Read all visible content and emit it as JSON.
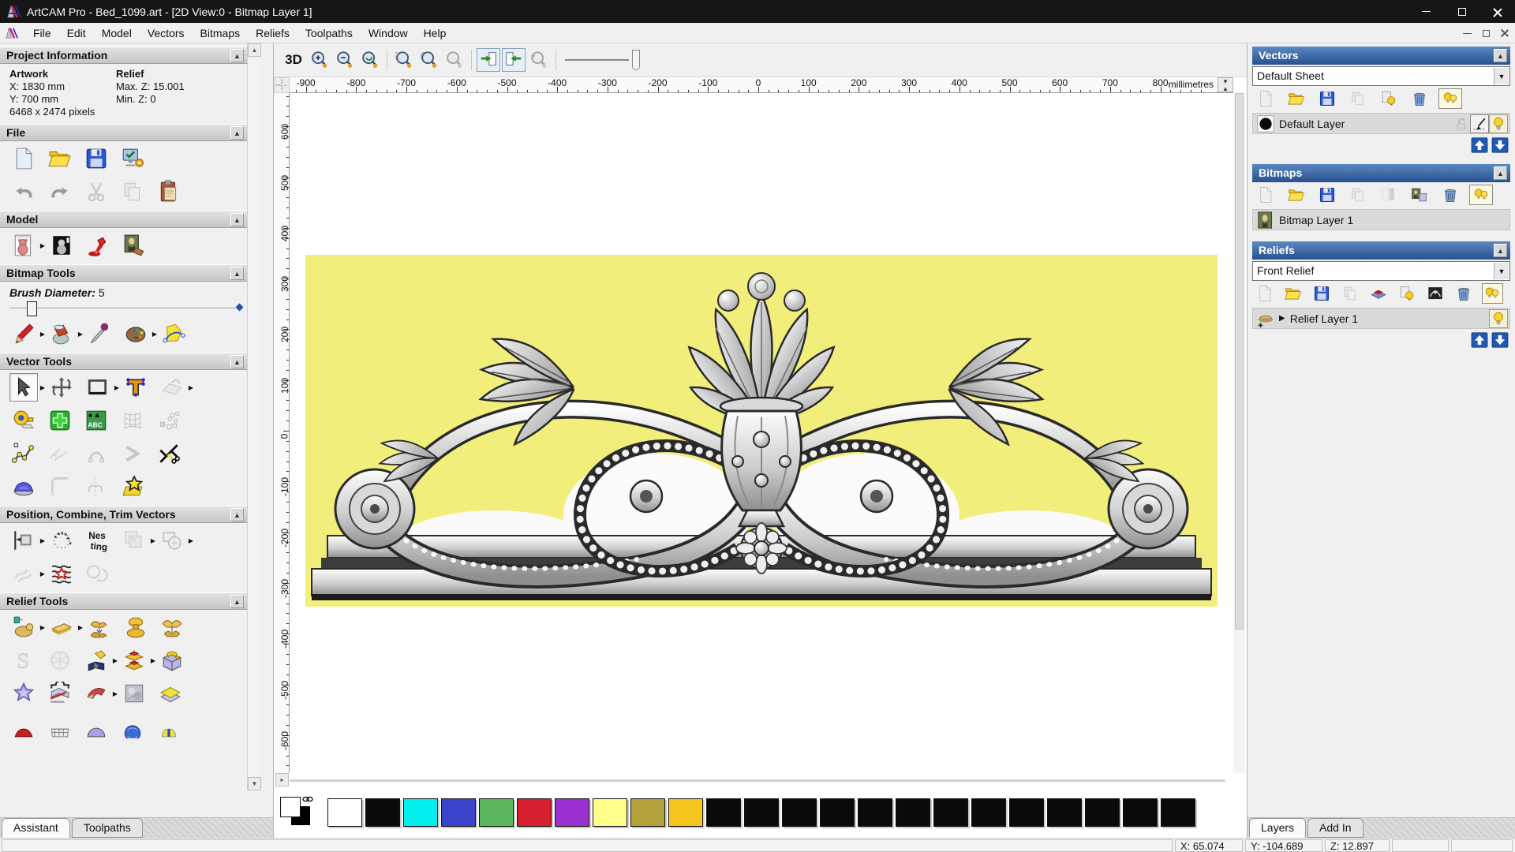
{
  "window": {
    "title": "ArtCAM Pro - Bed_1099.art - [2D View:0 - Bitmap Layer 1]",
    "menus": [
      "File",
      "Edit",
      "Model",
      "Vectors",
      "Bitmaps",
      "Reliefs",
      "Toolpaths",
      "Window",
      "Help"
    ]
  },
  "left_panel": {
    "sections": {
      "project": {
        "title": "Project Information",
        "artwork_label": "Artwork",
        "relief_label": "Relief",
        "x": "X: 1830 mm",
        "max_z": "Max. Z: 15.001",
        "y": "Y: 700 mm",
        "min_z": "Min. Z: 0",
        "pixels": "6468 x 2474 pixels"
      },
      "file": {
        "title": "File",
        "rows": [
          [
            {
              "n": "new-model-button",
              "k": "doc"
            },
            {
              "n": "open-model-button",
              "k": "folder"
            },
            {
              "n": "save-model-button",
              "k": "floppy"
            },
            {
              "n": "model-wizard-button",
              "k": "wizard"
            }
          ],
          [
            {
              "n": "undo-button",
              "k": "undo"
            },
            {
              "n": "redo-button",
              "k": "redo"
            },
            {
              "n": "cut-button",
              "k": "scissors",
              "dis": true
            },
            {
              "n": "copy-button",
              "k": "copy",
              "dis": true
            },
            {
              "n": "paste-button",
              "k": "paste"
            }
          ]
        ]
      },
      "model": {
        "title": "Model",
        "rows": [
          [
            {
              "n": "set-model-size-button",
              "k": "teddy_page",
              "fly": true
            },
            {
              "n": "greyscale-view-button",
              "k": "teddy_bw"
            },
            {
              "n": "lighting-button",
              "k": "lamp"
            },
            {
              "n": "texture-button",
              "k": "mona"
            }
          ]
        ]
      },
      "bitmap_tools": {
        "title": "Bitmap Tools",
        "brush_label": "Brush Diameter:",
        "brush_value": "5",
        "rows": [
          [
            {
              "n": "paint-button",
              "k": "pencil",
              "fly": true
            },
            {
              "n": "flood-fill-button",
              "k": "bucket",
              "fly": true
            },
            {
              "n": "pick-colour-button",
              "k": "dropper"
            },
            {
              "n": "colour-palette-button",
              "k": "palette",
              "fly": true
            },
            {
              "n": "bitmap-to-vector-button",
              "k": "btv"
            }
          ]
        ]
      },
      "vector_tools": {
        "title": "Vector Tools",
        "rows": [
          [
            {
              "n": "select-vectors-button",
              "k": "cursor",
              "pressed": true,
              "fly": true
            },
            {
              "n": "transform-vectors-button",
              "k": "transform"
            },
            {
              "n": "create-rectangle-button",
              "k": "rect",
              "fly": true
            },
            {
              "n": "create-text-button",
              "k": "textT"
            },
            {
              "n": "wrap-text-button",
              "k": "wrap",
              "dis": true,
              "fly": true
            }
          ],
          [
            {
              "n": "measure-button",
              "k": "measure"
            },
            {
              "n": "create-shape-button",
              "k": "plusg"
            },
            {
              "n": "paste-text-button",
              "k": "abc"
            },
            {
              "n": "distort-vectors-button",
              "k": "distort",
              "dis": true
            },
            {
              "n": "snap-points-button",
              "k": "snap",
              "dis": true
            }
          ],
          [
            {
              "n": "create-polyline-button",
              "k": "polyline"
            },
            {
              "n": "free-sketch-button",
              "k": "sketch",
              "dis": true
            },
            {
              "n": "arc-fit-button",
              "k": "arc",
              "dis": true
            },
            {
              "n": "create-arc-button",
              "k": "chevron",
              "dis": true
            },
            {
              "n": "trim-vectors-button",
              "k": "trim"
            }
          ],
          [
            {
              "n": "extrude-button",
              "k": "dome"
            },
            {
              "n": "fillet-button",
              "k": "fillet",
              "dis": true
            },
            {
              "n": "clip-vectors-button",
              "k": "clip",
              "dis": true
            },
            {
              "n": "vector-doctor-button",
              "k": "starfolder"
            }
          ]
        ]
      },
      "position": {
        "title": "Position, Combine, Trim Vectors",
        "rows": [
          [
            {
              "n": "align-vectors-button",
              "k": "align",
              "fly": true
            },
            {
              "n": "text-on-curve-button",
              "k": "textcurve"
            },
            {
              "n": "nesting-button",
              "k": "nesting"
            },
            {
              "n": "group-vectors-button",
              "k": "group",
              "dis": true,
              "fly": true
            },
            {
              "n": "weld-vectors-button",
              "k": "weld",
              "dis": true,
              "fly": true
            }
          ],
          [
            {
              "n": "join-vectors-button",
              "k": "join",
              "dis": true,
              "fly": true
            },
            {
              "n": "vector-texture-button",
              "k": "vtexture"
            },
            {
              "n": "interlock-vectors-button",
              "k": "interlock",
              "dis": true
            }
          ]
        ]
      },
      "relief_tools": {
        "title": "Relief Tools",
        "rows": [
          [
            {
              "n": "sculpting-button",
              "k": "sculpt",
              "fly": true
            },
            {
              "n": "smooth-relief-button",
              "k": "smoothbar",
              "fly": true
            },
            {
              "n": "add-relief-button",
              "k": "addgold"
            },
            {
              "n": "subtract-relief-button",
              "k": "subgold"
            },
            {
              "n": "merge-relief-button",
              "k": "mergegold"
            }
          ],
          [
            {
              "n": "smart-engrave-button",
              "k": "sgray",
              "dis": true
            },
            {
              "n": "weave-wizard-button",
              "k": "weave",
              "dis": true
            },
            {
              "n": "relief-from-image-button",
              "k": "bookb",
              "fly": true
            },
            {
              "n": "offset-relief-button",
              "k": "stackyr",
              "fly": true
            },
            {
              "n": "load-replace-relief-button",
              "k": "wrapbox"
            }
          ],
          [
            {
              "n": "shape-editor-button",
              "k": "starpurple"
            },
            {
              "n": "emboss-relief-button",
              "k": "clamp"
            },
            {
              "n": "two-rail-sweep-button",
              "k": "sweep",
              "fly": true
            },
            {
              "n": "texture-relief-button",
              "k": "texsq"
            },
            {
              "n": "offset-layer-button",
              "k": "offstack"
            }
          ],
          [
            {
              "n": "turn-relief-button",
              "k": "hat"
            },
            {
              "n": "weave-relief-button",
              "k": "basket"
            },
            {
              "n": "dome-relief-button",
              "k": "domep"
            },
            {
              "n": "ornament-relief-button",
              "k": "sphereb"
            },
            {
              "n": "wing-relief-button",
              "k": "wings"
            }
          ]
        ]
      }
    },
    "tabs": [
      {
        "label": "Assistant",
        "active": true
      },
      {
        "label": "Toolpaths",
        "active": false
      }
    ]
  },
  "toolbar": {
    "view3d_label": "3D",
    "buttons": [
      {
        "n": "view-3d-button",
        "k": "label3d"
      },
      {
        "n": "zoom-in-button",
        "k": "zoomin"
      },
      {
        "n": "zoom-out-button",
        "k": "zoomout"
      },
      {
        "n": "zoom-reset-button",
        "k": "zoomreset"
      },
      {
        "n": "sep1",
        "k": "sep"
      },
      {
        "n": "zoom-box-button",
        "k": "zoombox"
      },
      {
        "n": "zoom-selection-button",
        "k": "zoomsel"
      },
      {
        "n": "zoom-objects-button",
        "k": "zoomobj",
        "dis": true
      },
      {
        "n": "sep2",
        "k": "sep"
      },
      {
        "n": "pan-previous-button",
        "k": "panl",
        "pressed": true
      },
      {
        "n": "pan-next-button",
        "k": "panr",
        "pressed": true
      },
      {
        "n": "zoom-previous-button",
        "k": "zoomprev",
        "dis": true
      },
      {
        "n": "sep3",
        "k": "sep"
      },
      {
        "n": "simulation-slider",
        "k": "slider"
      }
    ]
  },
  "rulers": {
    "h_labels": [
      -900,
      -800,
      -700,
      -600,
      -500,
      -400,
      -300,
      -200,
      -100,
      0,
      100,
      200,
      300,
      400,
      500,
      600,
      700,
      800
    ],
    "v_labels": [
      600,
      500,
      400,
      300,
      200,
      100,
      0,
      -100,
      -200,
      -300,
      -400,
      -500,
      -600
    ],
    "units": "millimetres"
  },
  "canvas": {
    "artwork_bg": "#f1ee7c"
  },
  "right_panel": {
    "vectors": {
      "title": "Vectors",
      "sheet": "Default Sheet",
      "layer": "Default Layer",
      "icons": [
        {
          "n": "vector-new-layer-button",
          "k": "doc",
          "dis": true
        },
        {
          "n": "vector-open-button",
          "k": "folder"
        },
        {
          "n": "vector-save-button",
          "k": "floppy"
        },
        {
          "n": "vector-merge-button",
          "k": "copy",
          "dis": true
        },
        {
          "n": "sheet-bulb-button",
          "k": "bulbsheet"
        },
        {
          "n": "vector-delete-button",
          "k": "trash"
        },
        {
          "n": "vector-toggle-all-button",
          "k": "bulbs",
          "boxed": true
        }
      ]
    },
    "bitmaps": {
      "title": "Bitmaps",
      "layer": "Bitmap Layer 1",
      "icons": [
        {
          "n": "bitmap-new-layer-button",
          "k": "doc",
          "dis": true
        },
        {
          "n": "bitmap-open-button",
          "k": "folder"
        },
        {
          "n": "bitmap-save-button",
          "k": "floppy"
        },
        {
          "n": "bitmap-merge-button",
          "k": "copy",
          "dis": true
        },
        {
          "n": "bitmap-gradient-button",
          "k": "gradsq",
          "dis": true
        },
        {
          "n": "bitmap-copy-layer-button",
          "k": "monacopy"
        },
        {
          "n": "bitmap-delete-button",
          "k": "trash"
        },
        {
          "n": "bitmap-toggle-all-button",
          "k": "bulbs",
          "boxed": true
        }
      ]
    },
    "reliefs": {
      "title": "Reliefs",
      "relief": "Front Relief",
      "layer": "Relief Layer 1",
      "icons": [
        {
          "n": "relief-new-layer-button",
          "k": "doc",
          "dis": true
        },
        {
          "n": "relief-open-button",
          "k": "folder"
        },
        {
          "n": "relief-save-button",
          "k": "floppy"
        },
        {
          "n": "relief-merge-button",
          "k": "copy",
          "dis": true
        },
        {
          "n": "relief-stack-button",
          "k": "stackrp"
        },
        {
          "n": "relief-bulb-button",
          "k": "bulbsheet"
        },
        {
          "n": "relief-greyscale-button",
          "k": "reliefthumb"
        },
        {
          "n": "relief-delete-button",
          "k": "trash"
        },
        {
          "n": "relief-toggle-all-button",
          "k": "bulbs",
          "boxed": true
        }
      ]
    },
    "tabs": [
      {
        "label": "Layers",
        "active": true
      },
      {
        "label": "Add In",
        "active": false
      }
    ]
  },
  "palette": {
    "swatches": [
      "#ffffff",
      "#0a0a0a",
      "#00f0f0",
      "#3a45cc",
      "#5cb85c",
      "#d62030",
      "#9b30d0",
      "#ffff8c",
      "#b3a23a",
      "#f5c51e",
      "#0a0a0a",
      "#0a0a0a",
      "#0a0a0a",
      "#0a0a0a",
      "#0a0a0a",
      "#0a0a0a",
      "#0a0a0a",
      "#0a0a0a",
      "#0a0a0a",
      "#0a0a0a",
      "#0a0a0a",
      "#0a0a0a",
      "#0a0a0a"
    ]
  },
  "status_bar": {
    "x": "X: 65.074",
    "y": "Y: -104.689",
    "z": "Z: 12.897"
  }
}
